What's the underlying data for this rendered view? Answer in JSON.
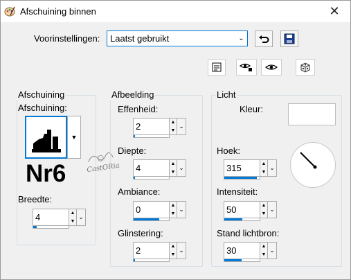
{
  "window": {
    "title": "Afschuining binnen"
  },
  "presets": {
    "label": "Voorinstellingen:",
    "selected": "Laatst gebruikt"
  },
  "bevel": {
    "group_label": "Afschuining",
    "field_label": "Afschuining:",
    "preview_label": "Nr6",
    "width_label": "Breedte:",
    "width_value": "4"
  },
  "image": {
    "group_label": "Afbeelding",
    "smoothness_label": "Effenheid:",
    "smoothness_value": "2",
    "depth_label": "Diepte:",
    "depth_value": "4",
    "ambience_label": "Ambiance:",
    "ambience_value": "0",
    "shininess_label": "Glinstering:",
    "shininess_value": "2"
  },
  "light": {
    "group_label": "Licht",
    "color_label": "Kleur:",
    "angle_label": "Hoek:",
    "angle_value": "315",
    "intensity_label": "Intensiteit:",
    "intensity_value": "50",
    "elevation_label": "Stand lichtbron:",
    "elevation_value": "30"
  },
  "watermark": {
    "text": "CastORia"
  },
  "colors": {
    "accent": "#0078d7",
    "light_color": "#ffffff"
  }
}
